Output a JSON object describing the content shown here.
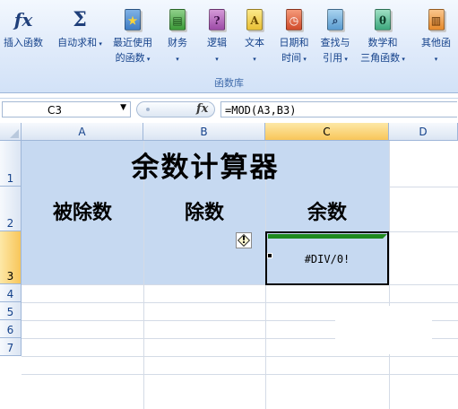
{
  "ribbon": {
    "group_label": "函数库",
    "buttons": [
      {
        "id": "insert-function",
        "line1": "插入函数",
        "line2": "",
        "icon": "fx-icon"
      },
      {
        "id": "autosum",
        "line1": "自动求和",
        "line2": "",
        "icon": "sigma-icon"
      },
      {
        "id": "recently-used",
        "line1": "最近使用",
        "line2": "的函数",
        "icon": "star-book-icon"
      },
      {
        "id": "financial",
        "line1": "财务",
        "line2": "",
        "icon": "finance-book-icon"
      },
      {
        "id": "logical",
        "line1": "逻辑",
        "line2": "",
        "icon": "question-book-icon"
      },
      {
        "id": "text",
        "line1": "文本",
        "line2": "",
        "icon": "text-book-icon"
      },
      {
        "id": "date-time",
        "line1": "日期和",
        "line2": "时间",
        "icon": "clock-book-icon"
      },
      {
        "id": "lookup",
        "line1": "查找与",
        "line2": "引用",
        "icon": "magnifier-book-icon"
      },
      {
        "id": "math-trig",
        "line1": "数学和",
        "line2": "三角函数",
        "icon": "theta-book-icon"
      },
      {
        "id": "more-functions",
        "line1": "其他函",
        "line2": "",
        "icon": "more-book-icon"
      }
    ]
  },
  "formula_bar": {
    "name_box": "C3",
    "fx_symbol": "fx",
    "formula": "=MOD(A3,B3)"
  },
  "grid": {
    "columns": [
      "A",
      "B",
      "C",
      "D"
    ],
    "rows": [
      "1",
      "2",
      "3",
      "4",
      "5",
      "6",
      "7"
    ],
    "selected_column": "C",
    "selected_row": "3",
    "title": "余数计算器",
    "headers": [
      "被除数",
      "除数",
      "余数"
    ],
    "c3_value": "#DIV/0!",
    "error_tag_symbol": "!"
  },
  "colors": {
    "cell_fill": "#c6d9f1",
    "ribbon_text": "#15428b",
    "selected_header": "#f8c65a"
  }
}
